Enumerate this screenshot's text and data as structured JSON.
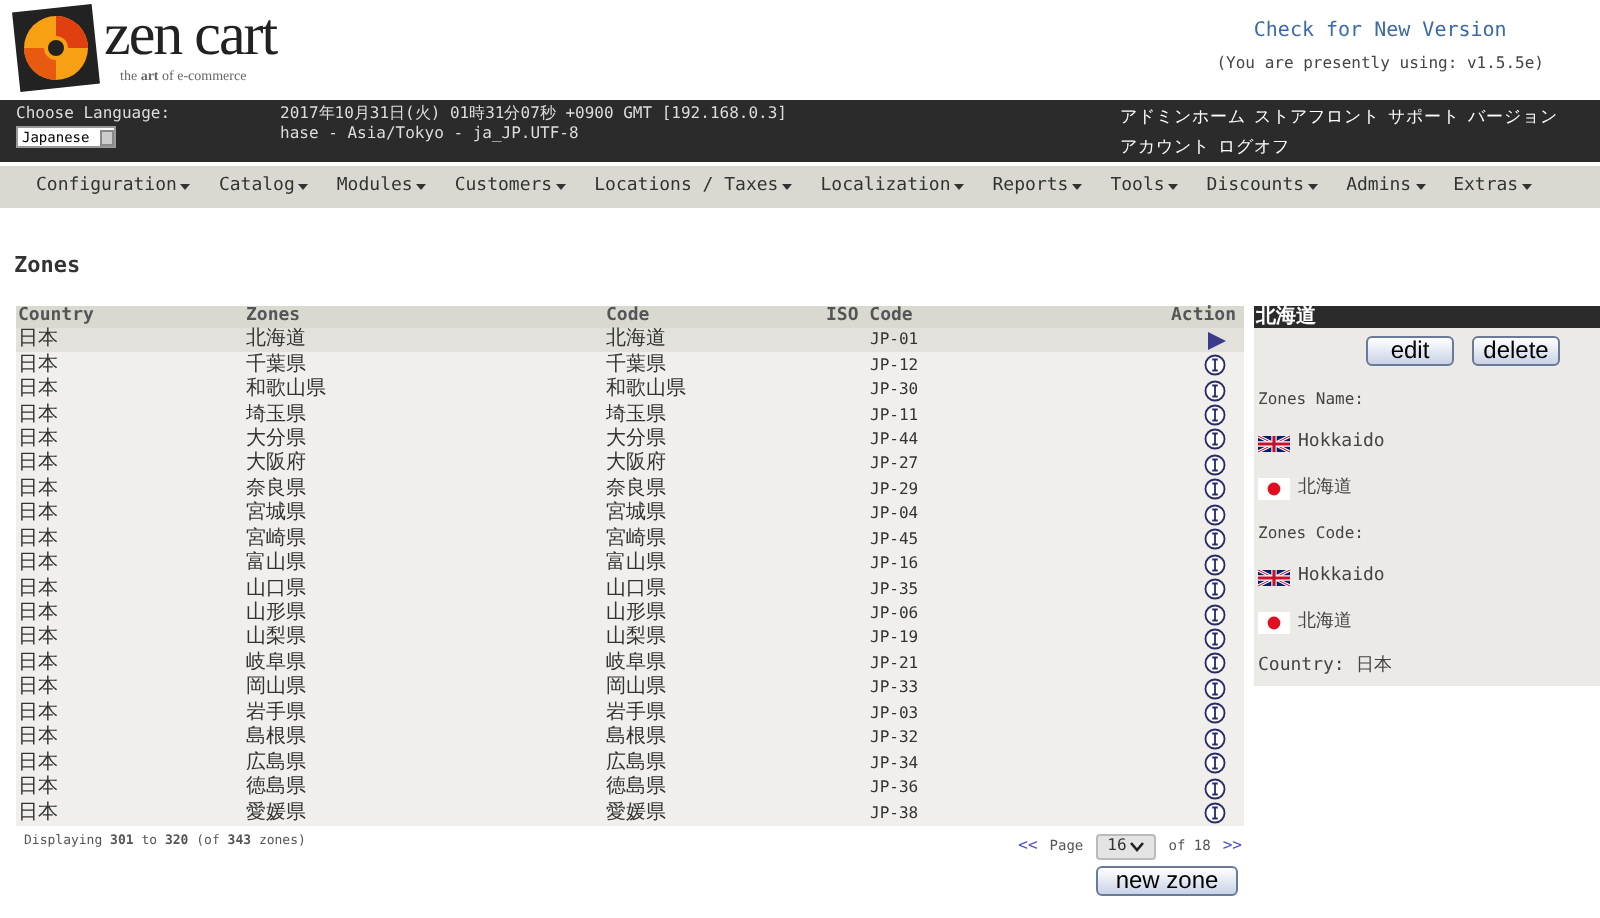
{
  "logo": {
    "name": "zen cart",
    "tagline": "the **art** of e-commerce"
  },
  "version": {
    "link": "Check for New Version",
    "note": "(You are presently using: v1.5.5e)"
  },
  "topbar": {
    "language_label": "Choose Language:",
    "language": "Japanese",
    "datetime": "2017年10月31日(火) 01時31分07秒 +0900 GMT [192.168.0.3]",
    "session": "hase - Asia/Tokyo - ja_JP.UTF-8",
    "links": [
      "アドミンホーム",
      "ストアフロント",
      "サポート",
      "バージョン",
      "アカウント",
      "ログオフ"
    ]
  },
  "menu": [
    "Configuration",
    "Catalog",
    "Modules",
    "Customers",
    "Locations / Taxes",
    "Localization",
    "Reports",
    "Tools",
    "Discounts",
    "Admins",
    "Extras"
  ],
  "page_title": "Zones",
  "table": {
    "columns": [
      "Country",
      "Zones",
      "Code",
      "ISO Code",
      "Action"
    ],
    "rows": [
      {
        "country": "日本",
        "zone": "北海道",
        "code": "北海道",
        "iso": "JP-01",
        "selected": true
      },
      {
        "country": "日本",
        "zone": "千葉県",
        "code": "千葉県",
        "iso": "JP-12",
        "selected": false
      },
      {
        "country": "日本",
        "zone": "和歌山県",
        "code": "和歌山県",
        "iso": "JP-30",
        "selected": false
      },
      {
        "country": "日本",
        "zone": "埼玉県",
        "code": "埼玉県",
        "iso": "JP-11",
        "selected": false
      },
      {
        "country": "日本",
        "zone": "大分県",
        "code": "大分県",
        "iso": "JP-44",
        "selected": false
      },
      {
        "country": "日本",
        "zone": "大阪府",
        "code": "大阪府",
        "iso": "JP-27",
        "selected": false
      },
      {
        "country": "日本",
        "zone": "奈良県",
        "code": "奈良県",
        "iso": "JP-29",
        "selected": false
      },
      {
        "country": "日本",
        "zone": "宮城県",
        "code": "宮城県",
        "iso": "JP-04",
        "selected": false
      },
      {
        "country": "日本",
        "zone": "宮崎県",
        "code": "宮崎県",
        "iso": "JP-45",
        "selected": false
      },
      {
        "country": "日本",
        "zone": "富山県",
        "code": "富山県",
        "iso": "JP-16",
        "selected": false
      },
      {
        "country": "日本",
        "zone": "山口県",
        "code": "山口県",
        "iso": "JP-35",
        "selected": false
      },
      {
        "country": "日本",
        "zone": "山形県",
        "code": "山形県",
        "iso": "JP-06",
        "selected": false
      },
      {
        "country": "日本",
        "zone": "山梨県",
        "code": "山梨県",
        "iso": "JP-19",
        "selected": false
      },
      {
        "country": "日本",
        "zone": "岐阜県",
        "code": "岐阜県",
        "iso": "JP-21",
        "selected": false
      },
      {
        "country": "日本",
        "zone": "岡山県",
        "code": "岡山県",
        "iso": "JP-33",
        "selected": false
      },
      {
        "country": "日本",
        "zone": "岩手県",
        "code": "岩手県",
        "iso": "JP-03",
        "selected": false
      },
      {
        "country": "日本",
        "zone": "島根県",
        "code": "島根県",
        "iso": "JP-32",
        "selected": false
      },
      {
        "country": "日本",
        "zone": "広島県",
        "code": "広島県",
        "iso": "JP-34",
        "selected": false
      },
      {
        "country": "日本",
        "zone": "徳島県",
        "code": "徳島県",
        "iso": "JP-36",
        "selected": false
      },
      {
        "country": "日本",
        "zone": "愛媛県",
        "code": "愛媛県",
        "iso": "JP-38",
        "selected": false
      }
    ]
  },
  "footer": {
    "displaying": "Displaying **301** to **320** (of **343** zones)",
    "prev": "<<",
    "page_label": "Page",
    "page": "16",
    "of": "of 18",
    "next": ">>",
    "new_button": "new zone"
  },
  "panel": {
    "title": "北海道",
    "buttons": [
      "edit",
      "delete"
    ],
    "name_label": "Zones Name:",
    "names": [
      {
        "kind": "uk",
        "text": "Hokkaido"
      },
      {
        "kind": "jp",
        "text": "北海道"
      }
    ],
    "code_label": "Zones Code:",
    "codes": [
      {
        "kind": "uk",
        "text": "Hokkaido"
      },
      {
        "kind": "jp",
        "text": "北海道"
      }
    ],
    "country": "Country: 日本"
  }
}
